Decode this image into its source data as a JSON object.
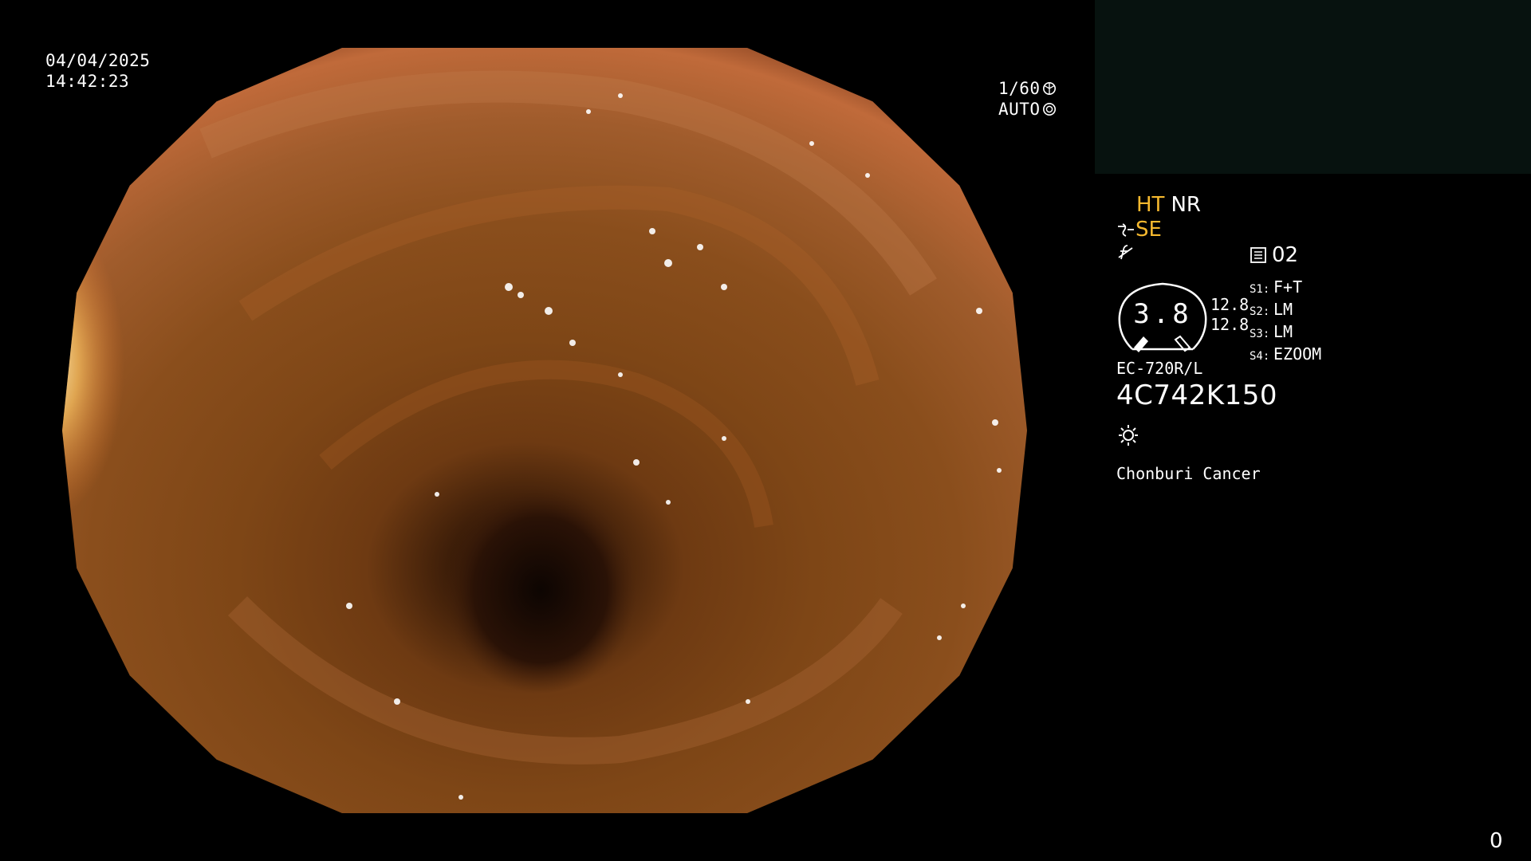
{
  "overlay": {
    "date": "04/04/2025",
    "time": "14:42:23",
    "shutter": "1/60",
    "iris": "AUTO"
  },
  "panel": {
    "mode_ht": "HT",
    "mode_nr": "NR",
    "se": "SE",
    "f_symbol": "f",
    "memo": "02",
    "dial_value": "3.8",
    "reading_1": "12.8",
    "reading_2": "12.8",
    "settings": [
      {
        "key": "S1:",
        "value": "F+T"
      },
      {
        "key": "S2:",
        "value": "LM"
      },
      {
        "key": "S3:",
        "value": "LM"
      },
      {
        "key": "S4:",
        "value": "EZOOM"
      }
    ],
    "model": "EC-720R/L",
    "serial": "4C742K150",
    "site": "Chonburi Cancer"
  },
  "counter": "0",
  "colors": {
    "accent_yellow": "#f5b82e",
    "tissue_dark": "#3a1c08",
    "tissue_mid": "#8a4a1a",
    "tissue_light": "#e88a3c"
  }
}
